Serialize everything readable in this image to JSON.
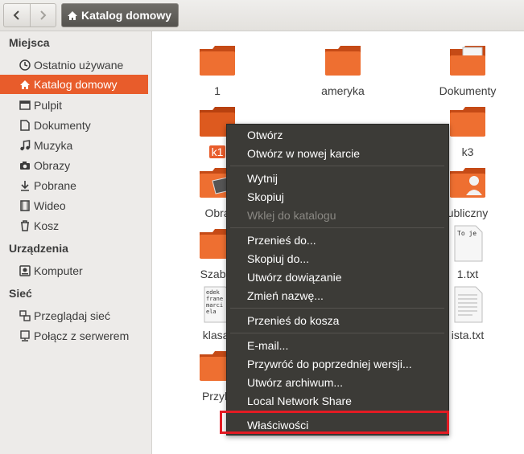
{
  "header": {
    "back_icon": "chevron-left-icon",
    "forward_icon": "chevron-right-icon",
    "path_icon": "home-icon",
    "path_label": "Katalog domowy"
  },
  "sidebar": {
    "places_title": "Miejsca",
    "places": [
      {
        "label": "Ostatnio używane",
        "icon": "clock-icon"
      },
      {
        "label": "Katalog domowy",
        "icon": "home-icon",
        "active": true
      },
      {
        "label": "Pulpit",
        "icon": "desktop-folder-icon"
      },
      {
        "label": "Dokumenty",
        "icon": "document-icon"
      },
      {
        "label": "Muzyka",
        "icon": "music-icon"
      },
      {
        "label": "Obrazy",
        "icon": "camera-icon"
      },
      {
        "label": "Pobrane",
        "icon": "download-icon"
      },
      {
        "label": "Wideo",
        "icon": "film-icon"
      },
      {
        "label": "Kosz",
        "icon": "trash-icon"
      }
    ],
    "devices_title": "Urządzenia",
    "devices": [
      {
        "label": "Komputer",
        "icon": "drive-icon"
      }
    ],
    "network_title": "Sieć",
    "network": [
      {
        "label": "Przeglądaj sieć",
        "icon": "network-icon"
      },
      {
        "label": "Połącz z serwerem",
        "icon": "server-icon"
      }
    ]
  },
  "files": [
    {
      "name": "1",
      "icon": "folder-icon"
    },
    {
      "name": "ameryka",
      "icon": "folder-icon"
    },
    {
      "name": "Dokumenty",
      "icon": "folder-documents-icon"
    },
    {
      "name": "k1",
      "icon": "folder-icon",
      "selected": true
    },
    {
      "name": "k3",
      "icon": "folder-icon"
    },
    {
      "name": "Obra",
      "icon": "folder-pictures-icon"
    },
    {
      "name": "ublicznyP",
      "display": "ubliczny",
      "icon": "folder-public-icon"
    },
    {
      "name": "Szablo",
      "icon": "folder-templates-icon"
    },
    {
      "name": "1.txt",
      "icon": "text-file-icon",
      "preview": "To je"
    },
    {
      "name": "klasa.",
      "icon": "text-file-icon",
      "preview": "edek\nfrane\nmarci\nela"
    },
    {
      "name": "ista.txt",
      "icon": "text-file-icon"
    },
    {
      "name": "Przykł",
      "icon": "folder-icon"
    }
  ],
  "context_menu": {
    "items": [
      {
        "label": "Otwórz"
      },
      {
        "label": "Otwórz w nowej karcie"
      },
      {
        "label": "Wytnij"
      },
      {
        "label": "Skopiuj"
      },
      {
        "label": "Wklej do katalogu",
        "disabled": true
      },
      {
        "label": "Przenieś do..."
      },
      {
        "label": "Skopiuj do..."
      },
      {
        "label": "Utwórz dowiązanie"
      },
      {
        "label": "Zmień nazwę..."
      },
      {
        "label": "Przenieś do kosza"
      },
      {
        "label": "E-mail..."
      },
      {
        "label": "Przywróć do poprzedniej wersji..."
      },
      {
        "label": "Utwórz archiwum..."
      },
      {
        "label": "Local Network Share"
      },
      {
        "label": "Właściwości"
      }
    ]
  },
  "colors": {
    "accent": "#e85c2b",
    "menu_bg": "#3c3b37",
    "highlight_border": "#e31b23"
  }
}
